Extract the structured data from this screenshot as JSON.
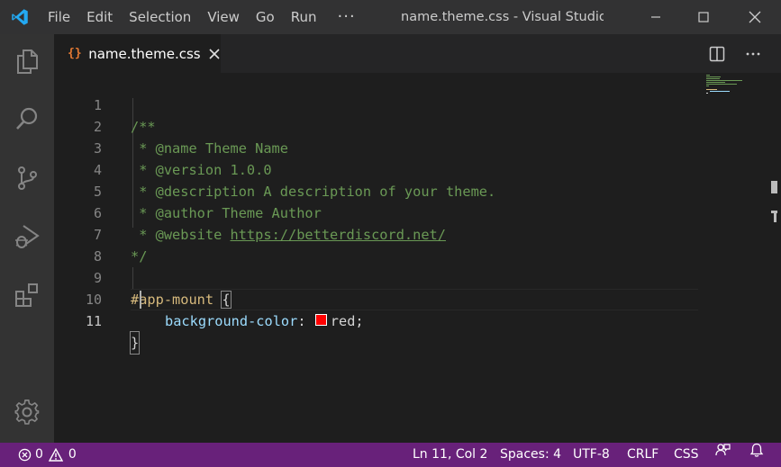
{
  "app": {
    "window_title": "name.theme.css - Visual Studio Cod..."
  },
  "menu": {
    "items": [
      "File",
      "Edit",
      "Selection",
      "View",
      "Go",
      "Run"
    ],
    "more": "···"
  },
  "tab": {
    "label": "name.theme.css",
    "file_icon": "{}"
  },
  "editor": {
    "line_numbers": [
      "1",
      "2",
      "3",
      "4",
      "5",
      "6",
      "7",
      "8",
      "9",
      "10",
      "11"
    ],
    "lines": {
      "l1": "/**",
      "l2": " * @name Theme Name",
      "l3": " * @version 1.0.0",
      "l4": " * @description A description of your theme.",
      "l5": " * @author Theme Author",
      "l6_prefix": " * @website ",
      "l6_link": "https://betterdiscord.net/",
      "l7": "*/",
      "l9_selector": "#app-mount",
      "l9_brace": "{",
      "l10_prop": "background-color",
      "l10_colon": ": ",
      "l10_value": "red",
      "l10_semi": ";",
      "l11_brace": "}"
    },
    "swatch_color": "#ff0000",
    "active_line": 11
  },
  "statusbar": {
    "errors": "0",
    "warnings": "0",
    "position": "Ln 11, Col 2",
    "spaces": "Spaces: 4",
    "encoding": "UTF-8",
    "eol": "CRLF",
    "language": "CSS"
  },
  "colors": {
    "accent_statusbar": "#68217a",
    "vscode_blue": "#23a9f2",
    "comment": "#6a9955",
    "selector": "#d7ba7d",
    "property": "#9cdcfe"
  }
}
